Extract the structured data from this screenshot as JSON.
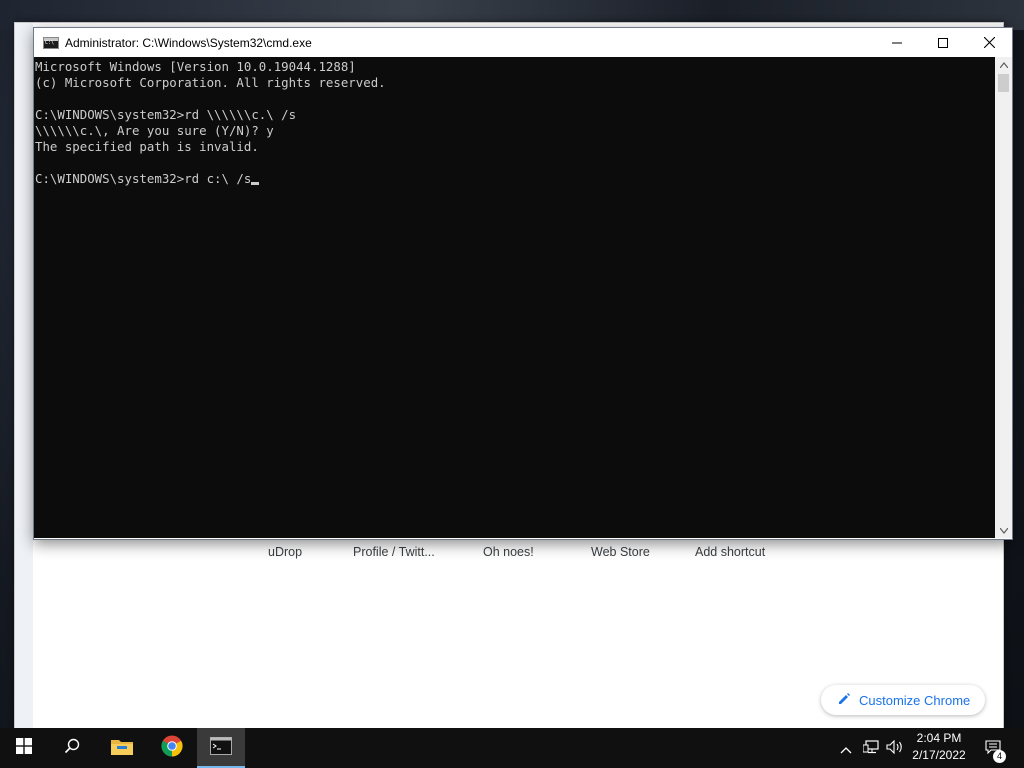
{
  "cmd_window": {
    "title": "Administrator: C:\\Windows\\System32\\cmd.exe",
    "console_lines": [
      "Microsoft Windows [Version 10.0.19044.1288]",
      "(c) Microsoft Corporation. All rights reserved.",
      "",
      "C:\\WINDOWS\\system32>rd \\\\\\\\\\\\c.\\ /s",
      "\\\\\\\\\\\\c.\\, Are you sure (Y/N)? y",
      "The specified path is invalid.",
      "",
      "C:\\WINDOWS\\system32>rd c:\\ /s"
    ],
    "controls": {
      "minimize": "minimize-icon",
      "maximize": "maximize-icon",
      "close": "close-icon"
    }
  },
  "chrome_window": {
    "shortcuts": [
      "uDrop",
      "Profile / Twitt...",
      "Oh noes!",
      "Web Store",
      "Add shortcut"
    ],
    "customize_label": "Customize Chrome"
  },
  "taskbar": {
    "apps": [
      "windows-start-icon",
      "search-icon",
      "file-explorer-icon",
      "chrome-icon",
      "cmd-icon"
    ],
    "clock": {
      "time": "2:04 PM",
      "date": "2/17/2022"
    },
    "notification_count": "4"
  },
  "colors": {
    "console_bg": "#0c0c0c",
    "console_fg": "#cccccc",
    "taskbar_bg": "#101010",
    "accent": "#1a73e8"
  }
}
